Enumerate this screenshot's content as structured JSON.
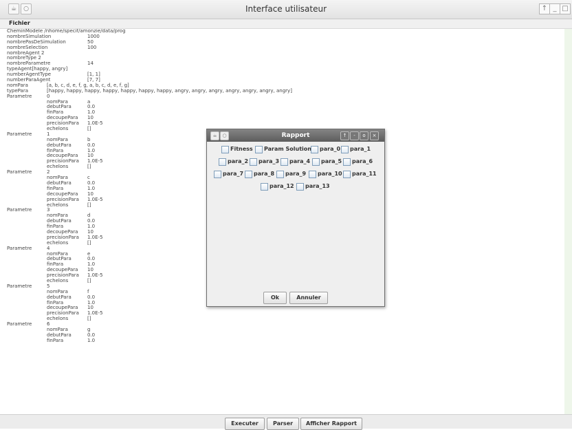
{
  "window": {
    "title": "Interface utilisateur",
    "buttons": [
      "↑",
      "_",
      "□"
    ]
  },
  "menu": {
    "fichier": "Fichier"
  },
  "content": {
    "lines": [
      [
        "CheminModele /nhome/specif/amonzie/data/prog",
        "",
        ""
      ],
      [
        "nombreSimulation",
        "",
        "1000"
      ],
      [
        "nombrePasDeSimulation",
        "",
        "50"
      ],
      [
        "nombreSelection",
        "",
        "100"
      ],
      [
        "nombreAgent  2",
        "",
        ""
      ],
      [
        "nombreType  2",
        "",
        ""
      ],
      [
        "nombreParametre",
        "",
        "14"
      ],
      [
        "typeAgent[happy, angry]",
        "",
        ""
      ],
      [
        "numberAgentType",
        "",
        "[1, 1]"
      ],
      [
        "numberParaAgent",
        "",
        "[7, 7]"
      ],
      [
        "nomPara",
        "[a, b, c, d, e, f, g, a, b, c, d, e, f, g]",
        ""
      ],
      [
        "typePara",
        "[happy, happy, happy, happy, happy, happy, happy, angry, angry, angry, angry, angry, angry, angry]",
        ""
      ],
      [
        "Parametre",
        "0",
        ""
      ],
      [
        "",
        "nomPara",
        "a"
      ],
      [
        "",
        "debutPara",
        "0.0"
      ],
      [
        "",
        "finPara",
        "1.0"
      ],
      [
        "",
        "decoupePara",
        "10"
      ],
      [
        "",
        "precisionPara",
        "1.0E-5"
      ],
      [
        "",
        "echelons",
        "[]"
      ],
      [
        "Parametre",
        "1",
        ""
      ],
      [
        "",
        "nomPara",
        "b"
      ],
      [
        "",
        "debutPara",
        "0.0"
      ],
      [
        "",
        "finPara",
        "1.0"
      ],
      [
        "",
        "decoupePara",
        "10"
      ],
      [
        "",
        "precisionPara",
        "1.0E-5"
      ],
      [
        "",
        "echelons",
        "[]"
      ],
      [
        "Parametre",
        "2",
        ""
      ],
      [
        "",
        "nomPara",
        "c"
      ],
      [
        "",
        "debutPara",
        "0.0"
      ],
      [
        "",
        "finPara",
        "1.0"
      ],
      [
        "",
        "decoupePara",
        "10"
      ],
      [
        "",
        "precisionPara",
        "1.0E-5"
      ],
      [
        "",
        "echelons",
        "[]"
      ],
      [
        "Parametre",
        "3",
        ""
      ],
      [
        "",
        "nomPara",
        "d"
      ],
      [
        "",
        "debutPara",
        "0.0"
      ],
      [
        "",
        "finPara",
        "1.0"
      ],
      [
        "",
        "decoupePara",
        "10"
      ],
      [
        "",
        "precisionPara",
        "1.0E-5"
      ],
      [
        "",
        "echelons",
        "[]"
      ],
      [
        "Parametre",
        "4",
        ""
      ],
      [
        "",
        "nomPara",
        "e"
      ],
      [
        "",
        "debutPara",
        "0.0"
      ],
      [
        "",
        "finPara",
        "1.0"
      ],
      [
        "",
        "decoupePara",
        "10"
      ],
      [
        "",
        "precisionPara",
        "1.0E-5"
      ],
      [
        "",
        "echelons",
        "[]"
      ],
      [
        "Parametre",
        "5",
        ""
      ],
      [
        "",
        "nomPara",
        "f"
      ],
      [
        "",
        "debutPara",
        "0.0"
      ],
      [
        "",
        "finPara",
        "1.0"
      ],
      [
        "",
        "decoupePara",
        "10"
      ],
      [
        "",
        "precisionPara",
        "1.0E-5"
      ],
      [
        "",
        "echelons",
        "[]"
      ],
      [
        "Parametre",
        "6",
        ""
      ],
      [
        "",
        "nomPara",
        "g"
      ],
      [
        "",
        "debutPara",
        "0.0"
      ],
      [
        "",
        "finPara",
        "1.0"
      ]
    ]
  },
  "buttons": {
    "executer": "Executer",
    "parser": "Parser",
    "afficher": "Afficher Rapport"
  },
  "dialog": {
    "title": "Rapport",
    "buttons": [
      "↑",
      "-",
      "o",
      "×"
    ],
    "checkboxes": [
      [
        "Fitness",
        "Param Solution",
        "para_0",
        "para_1"
      ],
      [
        "para_2",
        "para_3",
        "para_4",
        "para_5",
        "para_6"
      ],
      [
        "para_7",
        "para_8",
        "para_9",
        "para_10",
        "para_11"
      ],
      [
        "para_12",
        "para_13"
      ]
    ],
    "ok": "Ok",
    "annuler": "Annuler"
  },
  "colors": {
    "dialog_title": "#6e6e6e",
    "checkbox_border": "#7f9db9"
  }
}
